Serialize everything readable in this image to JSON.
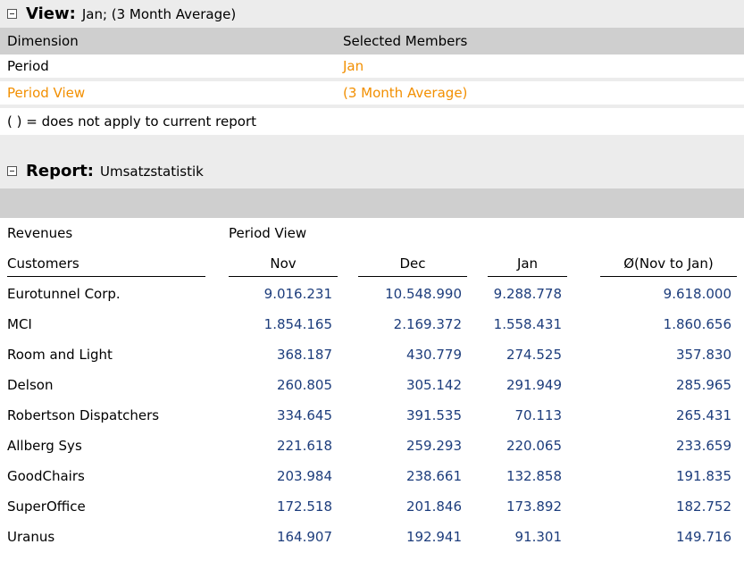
{
  "view": {
    "title": "View:",
    "subtitle": "Jan; (3 Month Average)",
    "columns": {
      "dimension": "Dimension",
      "selected": "Selected Members"
    },
    "rows": [
      {
        "dimension": "Period",
        "member": "Jan",
        "dim_color": "#000000",
        "member_color": "#f28f00"
      },
      {
        "dimension": "Period View",
        "member": "(3 Month Average)",
        "dim_color": "#f28f00",
        "member_color": "#f28f00"
      }
    ],
    "note": "( ) = does not apply to current report"
  },
  "report": {
    "title": "Report:",
    "subtitle": "Umsatzstatistik",
    "header1": {
      "measure": "Revenues",
      "axis": "Period View"
    },
    "header2": {
      "label": "Customers",
      "periods": [
        "Nov",
        "Dec",
        "Jan",
        "Ø(Nov to Jan)"
      ]
    },
    "rows": [
      {
        "customer": "Eurotunnel Corp.",
        "values": [
          "9.016.231",
          "10.548.990",
          "9.288.778",
          "9.618.000"
        ]
      },
      {
        "customer": "MCI",
        "values": [
          "1.854.165",
          "2.169.372",
          "1.558.431",
          "1.860.656"
        ]
      },
      {
        "customer": "Room and Light",
        "values": [
          "368.187",
          "430.779",
          "274.525",
          "357.830"
        ]
      },
      {
        "customer": "Delson",
        "values": [
          "260.805",
          "305.142",
          "291.949",
          "285.965"
        ]
      },
      {
        "customer": "Robertson Dispatchers",
        "values": [
          "334.645",
          "391.535",
          "70.113",
          "265.431"
        ]
      },
      {
        "customer": "Allberg Sys",
        "values": [
          "221.618",
          "259.293",
          "220.065",
          "233.659"
        ]
      },
      {
        "customer": "GoodChairs",
        "values": [
          "203.984",
          "238.661",
          "132.858",
          "191.835"
        ]
      },
      {
        "customer": "SuperOffice",
        "values": [
          "172.518",
          "201.846",
          "173.892",
          "182.752"
        ]
      },
      {
        "customer": "Uranus",
        "values": [
          "164.907",
          "192.941",
          "91.301",
          "149.716"
        ]
      }
    ],
    "value_color": "#1d3d7c"
  }
}
